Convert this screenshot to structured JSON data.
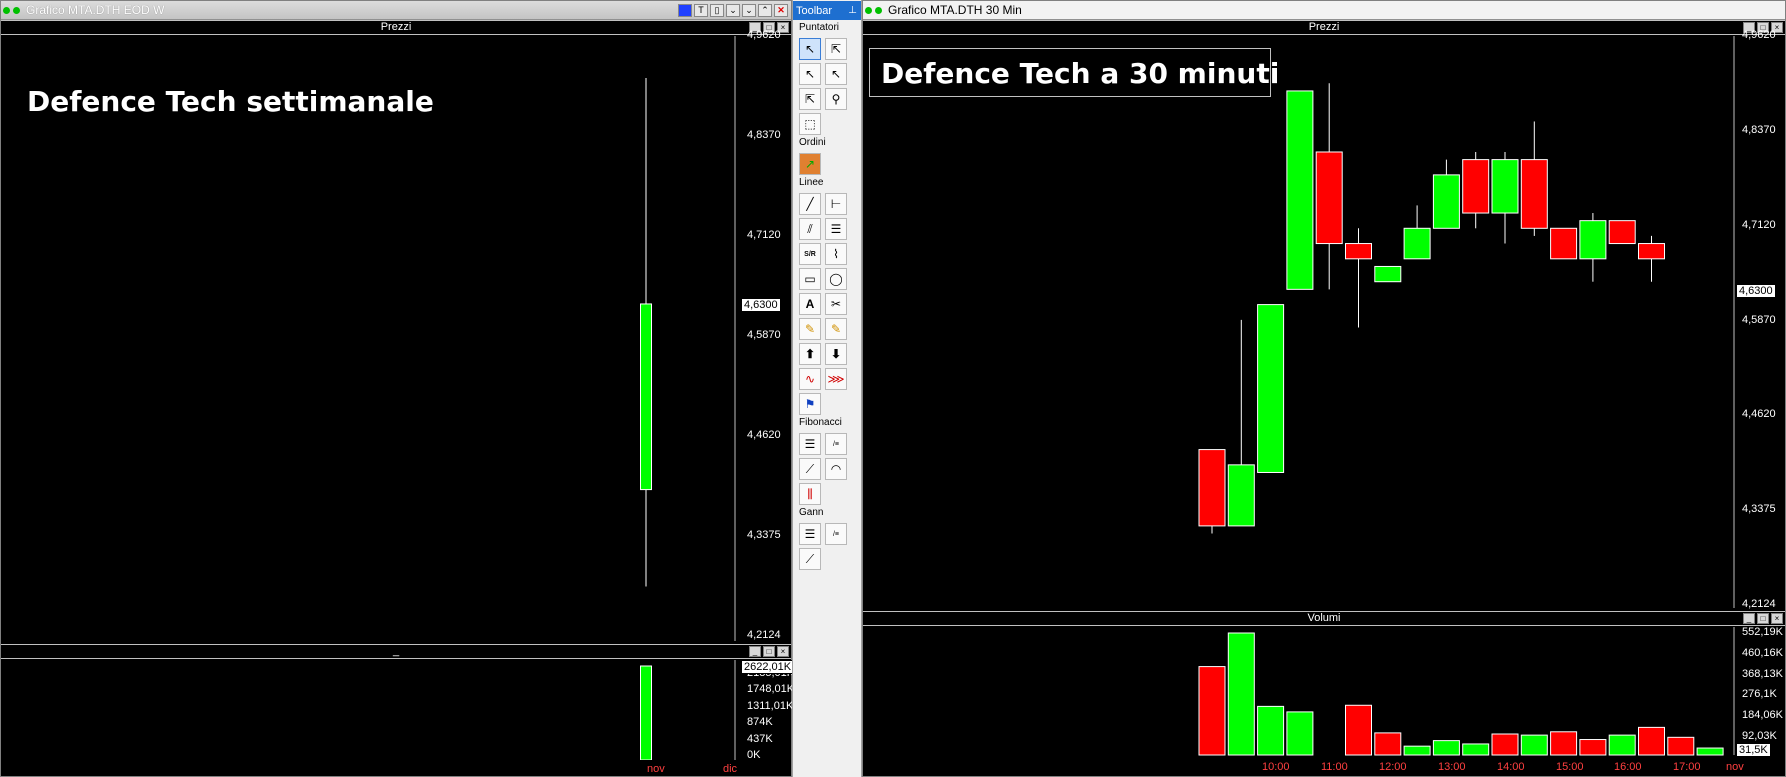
{
  "left_window": {
    "title": "Grafico MTA.DTH EOD W",
    "price_panel": "Prezzi",
    "volume_panel": "_",
    "overlay": "Defence Tech settimanale",
    "price_axis": [
      "4,9620",
      "4,8370",
      "4,7120",
      "4,5870",
      "4,4620",
      "4,3375",
      "4,2124"
    ],
    "last_price": "4,6300",
    "volume_axis": [
      "2185,01K",
      "1748,01K",
      "1311,01K",
      "874K",
      "437K",
      "0K"
    ],
    "last_volume": "2622,01K",
    "time_labels": [
      "nov",
      "dic"
    ]
  },
  "toolbar": {
    "title": "Toolbar",
    "sections": {
      "pointers": "Puntatori",
      "orders": "Ordini",
      "lines": "Linee",
      "fibonacci": "Fibonacci",
      "gann": "Gann"
    }
  },
  "right_window": {
    "title": "Grafico MTA.DTH 30 Min",
    "price_panel": "Prezzi",
    "volume_panel": "Volumi",
    "overlay": "Defence Tech a 30 minuti",
    "price_axis": [
      "4,9620",
      "4,8370",
      "4,7120",
      "4,5870",
      "4,4620",
      "4,3375",
      "4,2124"
    ],
    "last_price": "4,6300",
    "volume_axis": [
      "552,19K",
      "460,16K",
      "368,13K",
      "276,1K",
      "184,06K",
      "92,03K"
    ],
    "last_volume": "31,5K",
    "time_labels": [
      "10:00",
      "11:00",
      "12:00",
      "13:00",
      "14:00",
      "15:00",
      "16:00",
      "17:00",
      "nov"
    ]
  },
  "colors": {
    "up": "#00ff00",
    "down": "#ff0000",
    "background": "#000000"
  },
  "chart_data": [
    {
      "type": "candlestick",
      "title": "Defence Tech settimanale",
      "ylim": [
        4.2124,
        4.962
      ],
      "candles": [
        {
          "open": 4.4,
          "high": 4.91,
          "low": 4.28,
          "close": 4.63,
          "dir": "up"
        }
      ],
      "volumes": [
        {
          "value": 2622.01,
          "dir": "up"
        }
      ]
    },
    {
      "type": "candlestick",
      "title": "Defence Tech a 30 minuti",
      "ylim": [
        4.2124,
        4.962
      ],
      "candles": [
        {
          "open": 4.42,
          "high": 4.42,
          "low": 4.31,
          "close": 4.32,
          "dir": "down"
        },
        {
          "open": 4.32,
          "high": 4.59,
          "low": 4.32,
          "close": 4.4,
          "dir": "up"
        },
        {
          "open": 4.39,
          "high": 4.61,
          "low": 4.39,
          "close": 4.61,
          "dir": "up"
        },
        {
          "open": 4.63,
          "high": 4.89,
          "low": 4.63,
          "close": 4.89,
          "dir": "up"
        },
        {
          "open": 4.81,
          "high": 4.9,
          "low": 4.63,
          "close": 4.69,
          "dir": "down"
        },
        {
          "open": 4.69,
          "high": 4.71,
          "low": 4.58,
          "close": 4.67,
          "dir": "down"
        },
        {
          "open": 4.64,
          "high": 4.66,
          "low": 4.64,
          "close": 4.66,
          "dir": "up"
        },
        {
          "open": 4.67,
          "high": 4.74,
          "low": 4.67,
          "close": 4.71,
          "dir": "up"
        },
        {
          "open": 4.71,
          "high": 4.8,
          "low": 4.71,
          "close": 4.78,
          "dir": "up"
        },
        {
          "open": 4.8,
          "high": 4.81,
          "low": 4.71,
          "close": 4.73,
          "dir": "down"
        },
        {
          "open": 4.73,
          "high": 4.81,
          "low": 4.69,
          "close": 4.8,
          "dir": "up"
        },
        {
          "open": 4.8,
          "high": 4.85,
          "low": 4.7,
          "close": 4.71,
          "dir": "down"
        },
        {
          "open": 4.71,
          "high": 4.71,
          "low": 4.67,
          "close": 4.67,
          "dir": "down"
        },
        {
          "open": 4.67,
          "high": 4.73,
          "low": 4.64,
          "close": 4.72,
          "dir": "up"
        },
        {
          "open": 4.72,
          "high": 4.72,
          "low": 4.69,
          "close": 4.69,
          "dir": "down"
        },
        {
          "open": 4.69,
          "high": 4.7,
          "low": 4.64,
          "close": 4.67,
          "dir": "down"
        }
      ],
      "volumes": [
        {
          "value": 400,
          "dir": "down"
        },
        {
          "value": 552,
          "dir": "up"
        },
        {
          "value": 220,
          "dir": "up"
        },
        {
          "value": 195,
          "dir": "up"
        },
        {
          "value": 0,
          "dir": "none"
        },
        {
          "value": 225,
          "dir": "down"
        },
        {
          "value": 100,
          "dir": "down"
        },
        {
          "value": 40,
          "dir": "up"
        },
        {
          "value": 65,
          "dir": "up"
        },
        {
          "value": 50,
          "dir": "up"
        },
        {
          "value": 95,
          "dir": "down"
        },
        {
          "value": 90,
          "dir": "up"
        },
        {
          "value": 105,
          "dir": "down"
        },
        {
          "value": 70,
          "dir": "down"
        },
        {
          "value": 90,
          "dir": "up"
        },
        {
          "value": 125,
          "dir": "down"
        },
        {
          "value": 80,
          "dir": "down"
        },
        {
          "value": 31.5,
          "dir": "up"
        }
      ]
    }
  ]
}
